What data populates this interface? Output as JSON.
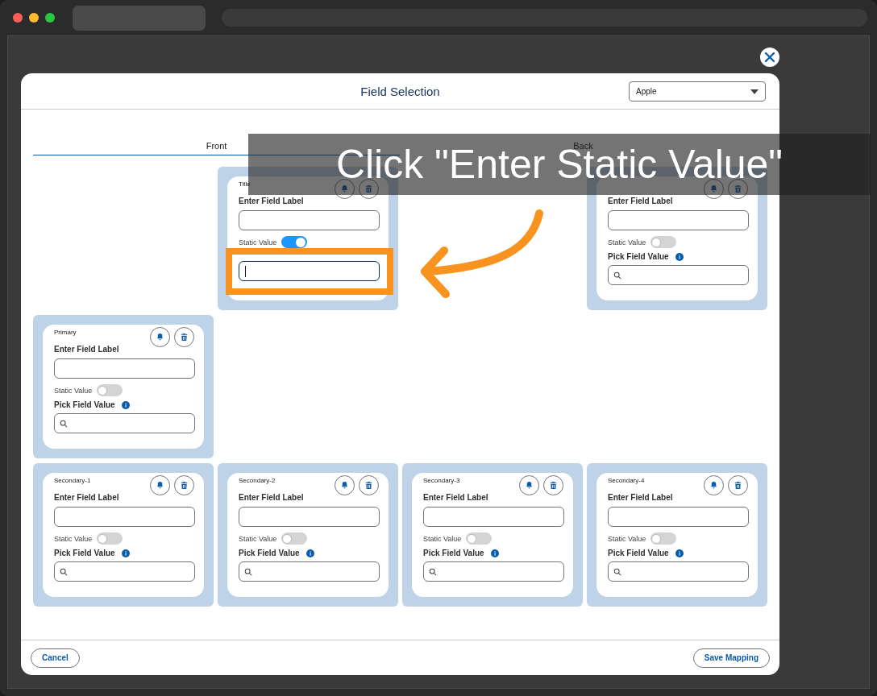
{
  "dialog": {
    "title": "Field Selection",
    "dropdown": {
      "value": "Apple"
    }
  },
  "tabs": [
    {
      "label": "Front",
      "selected": true
    },
    {
      "label": "Back",
      "selected": false
    }
  ],
  "grid_rows": [
    {
      "slots": [
        {
          "kind": "empty"
        },
        {
          "kind": "field",
          "label": "Title",
          "field_label": "Enter Field Label",
          "static_label": "Static Value",
          "static_on": true,
          "focused": true,
          "highlighted": true
        },
        {
          "kind": "empty"
        },
        {
          "kind": "field",
          "field_label": "Enter Field Label",
          "static_label": "Static Value",
          "static_on": false,
          "pick_label": "Pick Field Value"
        }
      ]
    },
    {
      "slots": [
        {
          "kind": "field",
          "label": "Primary",
          "field_label": "Enter Field Label",
          "static_label": "Static Value",
          "static_on": false,
          "pick_label": "Pick Field Value"
        },
        {
          "kind": "empty"
        },
        {
          "kind": "empty"
        },
        {
          "kind": "empty"
        }
      ]
    },
    {
      "slots": [
        {
          "kind": "field",
          "label": "Secondary-1",
          "field_label": "Enter Field Label",
          "static_label": "Static Value",
          "static_on": false,
          "pick_label": "Pick Field Value"
        },
        {
          "kind": "field",
          "label": "Secondary-2",
          "field_label": "Enter Field Label",
          "static_label": "Static Value",
          "static_on": false,
          "pick_label": "Pick Field Value"
        },
        {
          "kind": "field",
          "label": "Secondary-3",
          "field_label": "Enter Field Label",
          "static_label": "Static Value",
          "static_on": false,
          "pick_label": "Pick Field Value"
        },
        {
          "kind": "field",
          "label": "Secondary-4",
          "field_label": "Enter Field Label",
          "static_label": "Static Value",
          "static_on": false,
          "pick_label": "Pick Field Value"
        }
      ]
    }
  ],
  "footer": {
    "buttons": [
      "Cancel",
      "Save Mapping"
    ]
  },
  "tutorial": {
    "caption": "Click \"Enter Static Value\""
  }
}
